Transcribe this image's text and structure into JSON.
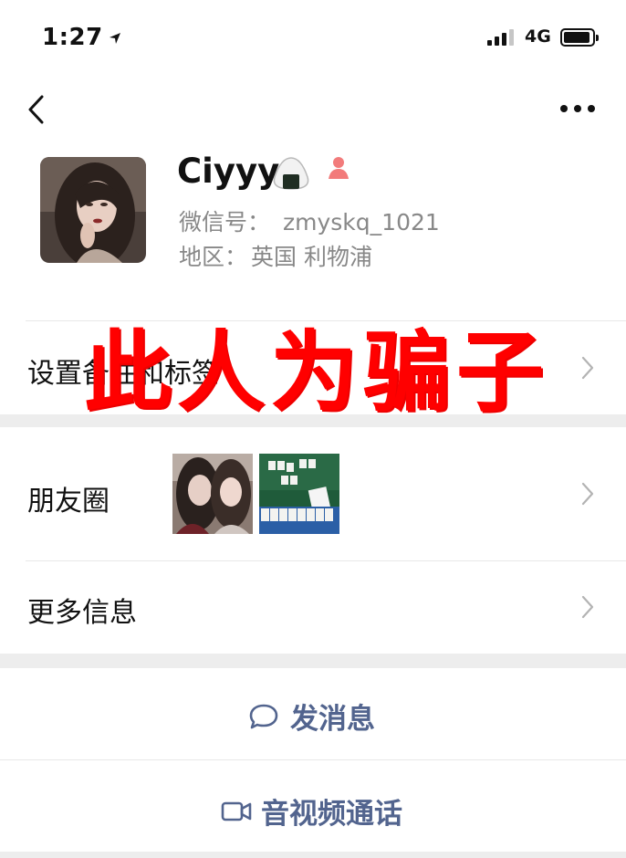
{
  "status_bar": {
    "time": "1:27",
    "network": "4G",
    "location_icon": "location-arrow-icon",
    "signal_icon": "signal-bars-icon",
    "battery_icon": "battery-icon"
  },
  "nav": {
    "back_icon": "chevron-left-icon",
    "more_icon": "more-dots-icon"
  },
  "profile": {
    "nickname": "Ciyyy",
    "nickname_emoji_icon": "rice-ball-icon",
    "gender_icon": "female-user-icon",
    "wechat_id_label": "微信号：",
    "wechat_id": "zmyskq_1021",
    "region_label": "地区：",
    "region": "英国 利物浦"
  },
  "overlay_warning": "此人为骗子",
  "rows": {
    "remark_label": "设置备注和标签",
    "moments_label": "朋友圈",
    "more_info_label": "更多信息"
  },
  "actions": {
    "message_label": "发消息",
    "call_label": "音视频通话"
  },
  "colors": {
    "action_blue": "#52648e",
    "warning_red": "#ff0000",
    "secondary_gray": "#888888",
    "separator": "#ededed"
  }
}
